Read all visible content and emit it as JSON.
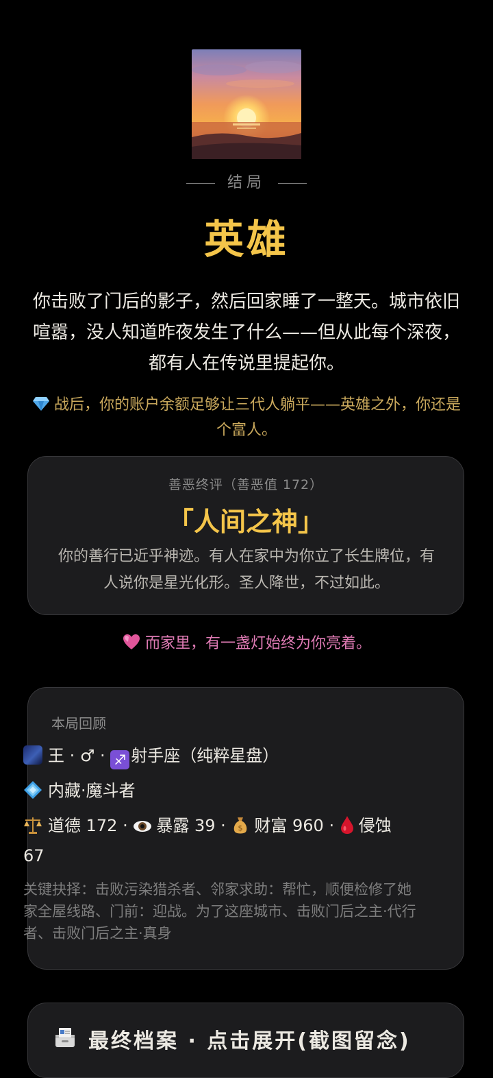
{
  "ending": {
    "label": "结局",
    "title": "英雄",
    "story": "你击败了门后的影子，然后回家睡了一整天。城市依旧喧嚣，没人知道昨夜发生了什么——但从此每个深夜，都有人在传说里提起你。",
    "wealth_note": "战后，你的账户余额足够让三代人躺平——英雄之外，你还是个富人。",
    "wealth_icon": "gem-icon"
  },
  "judgement": {
    "heading": "善恶终评（善恶值 172）",
    "title": "「人间之神」",
    "body": "你的善行已近乎神迹。有人在家中为你立了长生牌位，有人说你是星光化形。圣人降世，不过如此。"
  },
  "family_note": {
    "icon": "heart-icon",
    "text": "而家里，有一盏灯始终为你亮着。"
  },
  "review": {
    "heading": "本局回顾",
    "identity": "王 · ♂ · ",
    "sign": "射手座（纯粹星盘）",
    "trait": "内藏·魔斗者",
    "stats_1": "道德 172 · ",
    "stats_2": "暴露 39 · ",
    "stats_3": "财富 960 · ",
    "stats_4": "侵蚀 67",
    "choices": "关键抉择：击败污染猎杀者、邻家求助：帮忙，顺便检修了她家全屋线路、门前：迎战。为了这座城市、击败门后之主·代行者、击败门后之主·真身"
  },
  "archive": {
    "label": "最终档案 · 点击展开(截图留念)",
    "icon": "archive-icon"
  },
  "colors": {
    "gold": "#f4c54a",
    "pink": "#e07bb5",
    "muted_gold": "#c9a85c",
    "card_bg": "#1c1c1e"
  }
}
